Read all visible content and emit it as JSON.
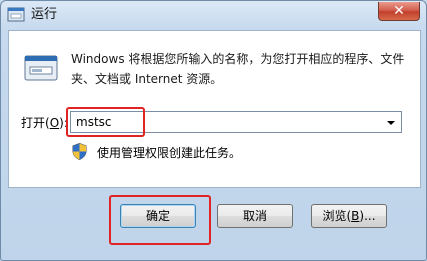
{
  "window": {
    "title": "运行",
    "icon": "run-icon",
    "close_glyph": "✕"
  },
  "dialog": {
    "description": "Windows 将根据您所输入的名称，为您打开相应的程序、文件夹、文档或 Internet 资源。",
    "open_label": "打开(",
    "open_label_mnemonic": "O",
    "open_label_suffix": "):",
    "input_value": "mstsc",
    "admin_note": "使用管理权限创建此任务。"
  },
  "buttons": {
    "ok": "确定",
    "cancel": "取消",
    "browse_prefix": "浏览(",
    "browse_mnemonic": "B",
    "browse_suffix": ")..."
  },
  "colors": {
    "highlight": "#e02424",
    "close_button": "#c1402b",
    "frame": "#bfd4ea"
  }
}
